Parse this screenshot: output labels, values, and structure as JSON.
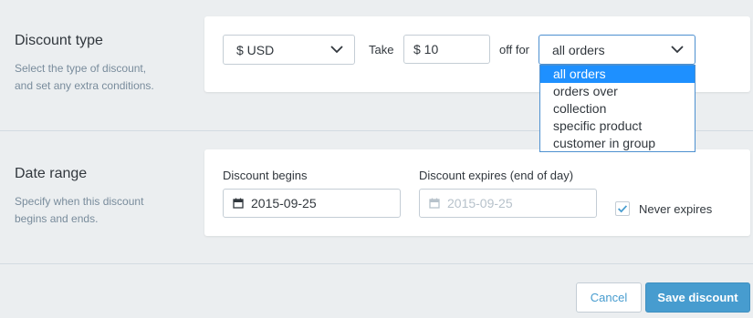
{
  "discount_type": {
    "title": "Discount type",
    "description_line1": "Select the type of discount,",
    "description_line2": "and set any extra conditions.",
    "currency_select": "$ USD",
    "take_label": "Take",
    "amount_value": "$ 10",
    "off_for_label": "off for",
    "applies_to_select": "all orders",
    "applies_to_options": [
      "all orders",
      "orders over",
      "collection",
      "specific product",
      "customer in group"
    ]
  },
  "date_range": {
    "title": "Date range",
    "description_line1": "Specify when this discount",
    "description_line2": "begins and ends.",
    "begins_label": "Discount begins",
    "begins_value": "2015-09-25",
    "expires_label": "Discount expires (end of day)",
    "expires_placeholder": "2015-09-25",
    "never_expires_label": "Never expires",
    "never_expires_checked": true
  },
  "actions": {
    "cancel_label": "Cancel",
    "save_label": "Save discount"
  },
  "colors": {
    "accent": "#479ccf",
    "selected_option": "#1e90ff"
  }
}
